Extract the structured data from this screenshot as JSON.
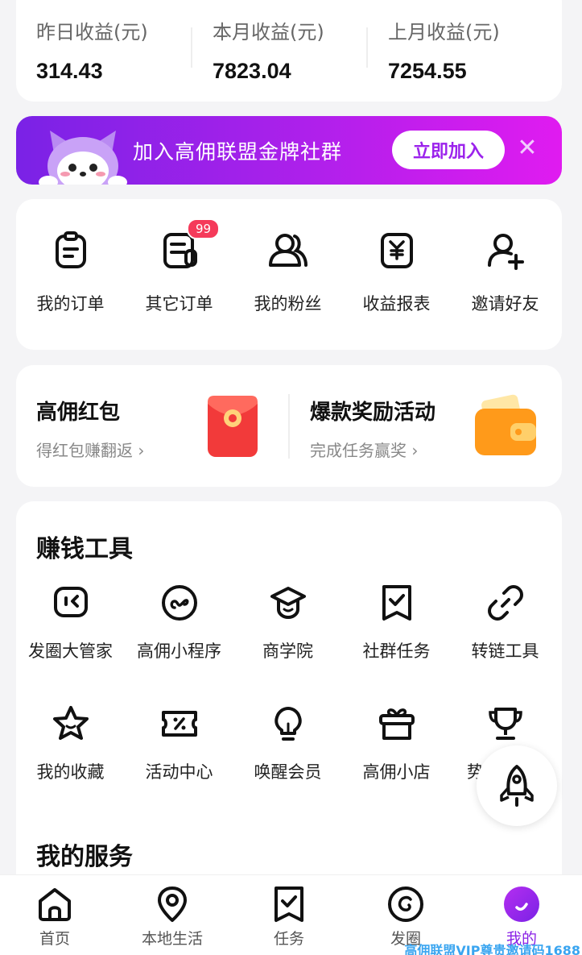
{
  "earnings": [
    {
      "label": "昨日收益(元)",
      "value": "314.43"
    },
    {
      "label": "本月收益(元)",
      "value": "7823.04"
    },
    {
      "label": "上月收益(元)",
      "value": "7254.55"
    }
  ],
  "banner": {
    "text": "加入高佣联盟金牌社群",
    "button": "立即加入",
    "close": "✕"
  },
  "quick": [
    {
      "label": "我的订单",
      "icon": "order-icon"
    },
    {
      "label": "其它订单",
      "icon": "other-order-icon",
      "badge": "99"
    },
    {
      "label": "我的粉丝",
      "icon": "fans-icon"
    },
    {
      "label": "收益报表",
      "icon": "report-icon"
    },
    {
      "label": "邀请好友",
      "icon": "invite-icon"
    }
  ],
  "promo": {
    "left": {
      "title": "高佣红包",
      "sub": "得红包赚翻返 ›"
    },
    "right": {
      "title": "爆款奖励活动",
      "sub": "完成任务赢奖 ›"
    }
  },
  "tools": {
    "title": "赚钱工具",
    "row1": [
      "发圈大管家",
      "高佣小程序",
      "商学院",
      "社群任务",
      "转链工具"
    ],
    "row2": [
      "我的收藏",
      "活动中心",
      "唤醒会员",
      "高佣小店",
      "势"
    ]
  },
  "services": {
    "title": "我的服务"
  },
  "nav": [
    {
      "label": "首页"
    },
    {
      "label": "本地生活"
    },
    {
      "label": "任务"
    },
    {
      "label": "发圈"
    },
    {
      "label": "我的"
    }
  ],
  "watermark": "高佣联盟VIP尊贵邀请码1688",
  "colors": {
    "accent": "#8a21e6",
    "badge": "#f53a5a",
    "red_packet": "#f23a3a",
    "wallet": "#ff9a1a"
  }
}
